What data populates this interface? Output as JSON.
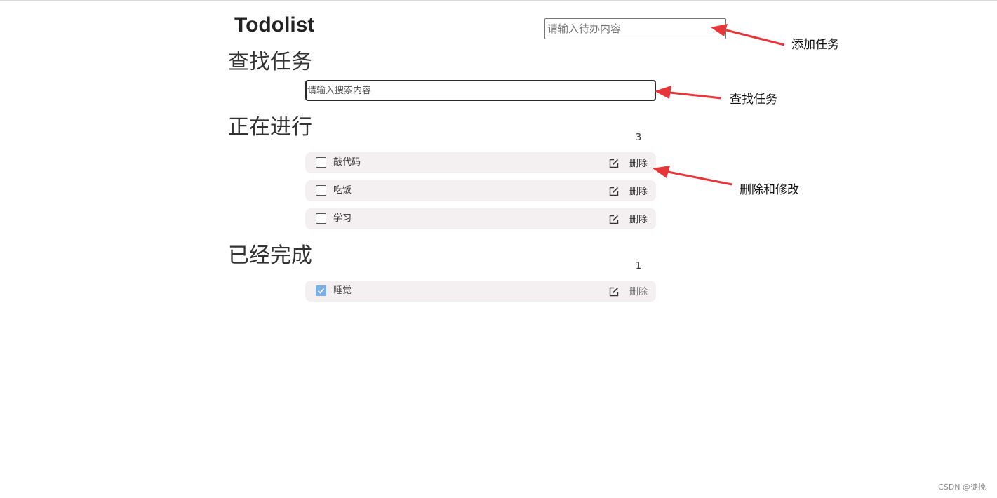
{
  "header": {
    "title": "Todolist",
    "add_placeholder": "请输入待办内容",
    "add_value": ""
  },
  "search": {
    "title": "查找任务",
    "placeholder": "请输入搜索内容",
    "value": ""
  },
  "in_progress": {
    "title": "正在进行",
    "count": "3",
    "items": [
      {
        "text": "敲代码",
        "checked": false,
        "delete_label": "删除"
      },
      {
        "text": "吃饭",
        "checked": false,
        "delete_label": "删除"
      },
      {
        "text": "学习",
        "checked": false,
        "delete_label": "删除"
      }
    ]
  },
  "completed": {
    "title": "已经完成",
    "count": "1",
    "items": [
      {
        "text": "睡觉",
        "checked": true,
        "delete_label": "删除"
      }
    ]
  },
  "annotations": {
    "add_task": "添加任务",
    "find_task": "查找任务",
    "delete_and_edit": "删除和修改",
    "arrow_color": "#e8353a"
  },
  "watermark": "CSDN @徒挽",
  "colors": {
    "item_background": "#f4eff0",
    "checkbox_checked": "#7aaee7"
  }
}
